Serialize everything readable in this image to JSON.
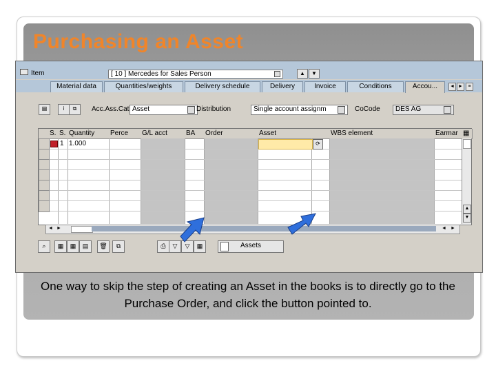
{
  "slide": {
    "title": "Purchasing an Asset",
    "caption": "One way to skip the step of creating an Asset in the books is to directly go to the Purchase Order, and click the button pointed to."
  },
  "colors": {
    "title": "#f0852a",
    "arrow": "#2f6fdc",
    "asset_cell": "#ffeaa8",
    "tab_strip": "#b5c7d9"
  },
  "item": {
    "label": "Item",
    "value": "[ 10 ] Mercedes for Sales Person",
    "nav_up": "▲",
    "nav_down": "▼"
  },
  "tabs": [
    {
      "label": "Material data"
    },
    {
      "label": "Quantities/weights"
    },
    {
      "label": "Delivery schedule"
    },
    {
      "label": "Delivery"
    },
    {
      "label": "Invoice"
    },
    {
      "label": "Conditions"
    },
    {
      "label": "Accou..."
    }
  ],
  "account": {
    "acct_cat_label": "Acc.Ass.Cat",
    "acct_cat_value": "Asset",
    "distribution_label": "Distribution",
    "distribution_value": "Single account assignm",
    "cocode_label": "CoCode",
    "cocode_value": "DES AG"
  },
  "table": {
    "columns": [
      "S.",
      "S.",
      "Quantity",
      "Perce",
      "G/L acct",
      "BA",
      "Order",
      "Asset",
      "",
      "WBS element",
      "Earmar"
    ],
    "rows": [
      {
        "no": "1",
        "quantity": "1.000",
        "asset": ""
      }
    ]
  },
  "toolbar": {
    "assets_label": "Assets"
  }
}
